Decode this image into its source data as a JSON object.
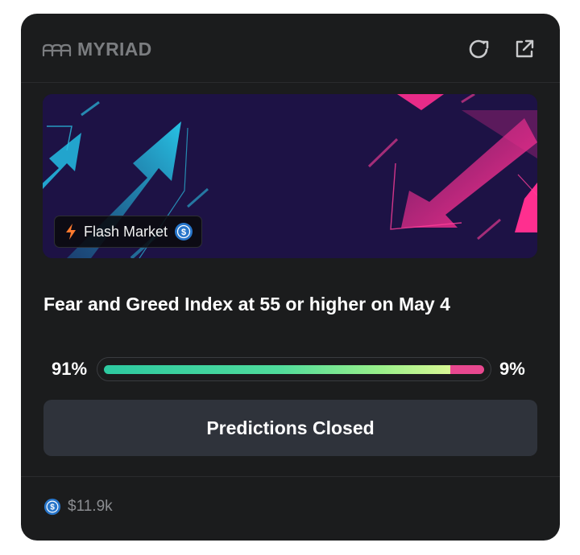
{
  "header": {
    "brand": "MYRIAD",
    "refresh_icon": "refresh-icon",
    "share_icon": "external-link-icon"
  },
  "banner": {
    "badge_label": "Flash Market",
    "badge_icon": "lightning-icon",
    "currency_icon": "usdc-coin-icon"
  },
  "market": {
    "title": "Fear and Greed Index at 55 or higher on May 4",
    "yes_percent": "91%",
    "no_percent": "9%",
    "yes_fraction": 0.91
  },
  "action": {
    "label": "Predictions Closed"
  },
  "footer": {
    "volume": "$11.9k"
  },
  "colors": {
    "card": "#1b1c1d",
    "button": "#2f333b",
    "yes_start": "#2dc9a0",
    "yes_end": "#d9f894",
    "no": "#e8488f",
    "usdc": "#2775ca"
  }
}
